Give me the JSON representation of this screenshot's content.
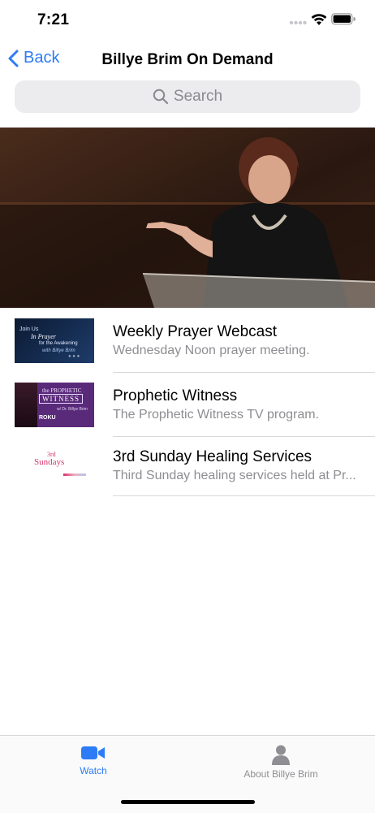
{
  "status": {
    "time": "7:21"
  },
  "nav": {
    "back_label": "Back",
    "title": "Billye Brim On Demand"
  },
  "search": {
    "placeholder": "Search"
  },
  "items": [
    {
      "title": "Weekly Prayer Webcast",
      "subtitle": "Wednesday Noon prayer meeting.",
      "thumb": {
        "line1": "Join Us",
        "line2": "In Prayer",
        "line3": "for the Awakening",
        "line4": "with Billye Brim"
      }
    },
    {
      "title": "Prophetic Witness",
      "subtitle": "The Prophetic Witness TV program.",
      "thumb": {
        "line1": "the PROPHETIC",
        "line2": "WITNESS",
        "line3": "w/ Dr. Billye Brim",
        "line4": "ROKU"
      }
    },
    {
      "title": "3rd Sunday Healing Services",
      "subtitle": "Third Sunday healing services held at Pr...",
      "thumb": {
        "line1": "3rd",
        "line2": "Sundays"
      }
    }
  ],
  "tabs": [
    {
      "label": "Watch",
      "icon": "video-camera-icon",
      "active": true
    },
    {
      "label": "About Billye Brim",
      "icon": "person-icon",
      "active": false
    }
  ],
  "colors": {
    "accent": "#2d7cf6",
    "inactive": "#8e8e93",
    "purple": "#5a2a7a",
    "pink": "#d6336c"
  }
}
